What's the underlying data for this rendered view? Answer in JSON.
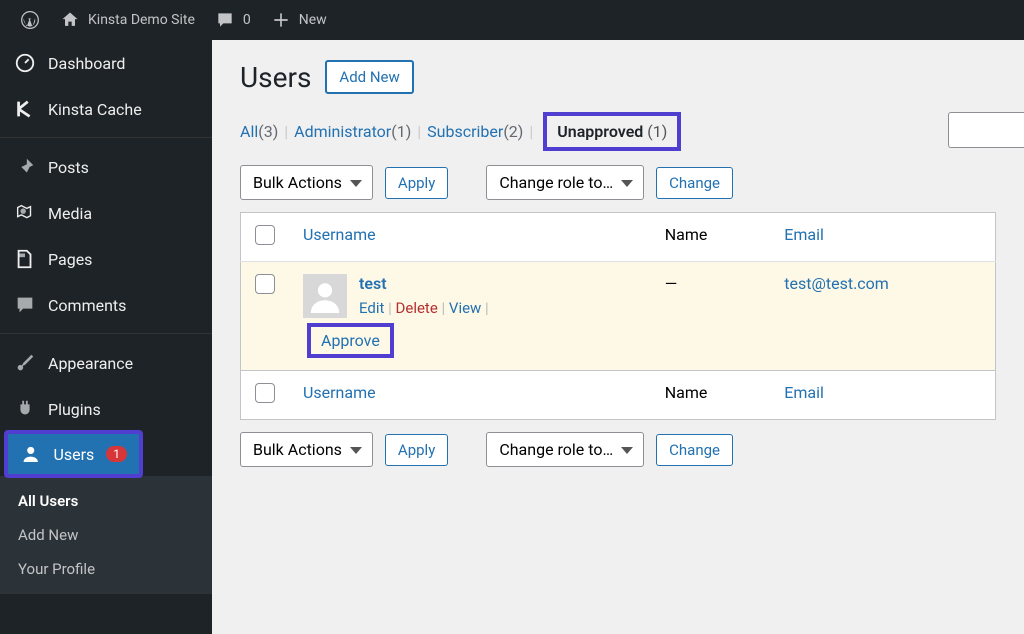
{
  "adminbar": {
    "site_name": "Kinsta Demo Site",
    "comments_count": "0",
    "new_label": "New"
  },
  "sidebar": {
    "items": [
      {
        "label": "Dashboard"
      },
      {
        "label": "Kinsta Cache"
      },
      {
        "label": "Posts"
      },
      {
        "label": "Media"
      },
      {
        "label": "Pages"
      },
      {
        "label": "Comments"
      },
      {
        "label": "Appearance"
      },
      {
        "label": "Plugins"
      },
      {
        "label": "Users",
        "badge": "1"
      }
    ],
    "submenu": [
      {
        "label": "All Users"
      },
      {
        "label": "Add New"
      },
      {
        "label": "Your Profile"
      }
    ]
  },
  "page": {
    "title": "Users",
    "add_new": "Add New"
  },
  "filters": {
    "all": "All",
    "all_count": "(3)",
    "admin": "Administrator",
    "admin_count": "(1)",
    "subscriber": "Subscriber",
    "subscriber_count": "(2)",
    "unapproved": "Unapproved",
    "unapproved_count": "(1)"
  },
  "actions": {
    "bulk": "Bulk Actions",
    "apply": "Apply",
    "change_role": "Change role to…",
    "change": "Change"
  },
  "columns": {
    "username": "Username",
    "name": "Name",
    "email": "Email"
  },
  "row": {
    "username": "test",
    "name": "—",
    "email": "test@test.com",
    "edit": "Edit",
    "delete": "Delete",
    "view": "View",
    "approve": "Approve"
  }
}
